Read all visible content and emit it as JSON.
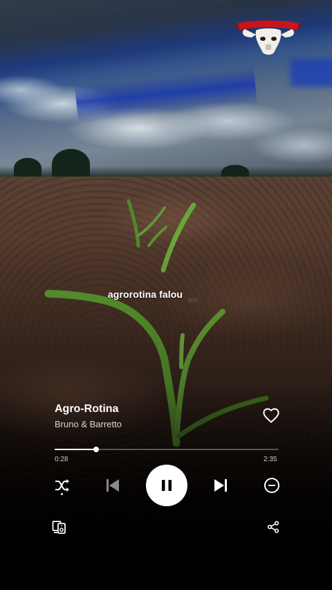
{
  "player": {
    "lyric_line": "agrorotina falou",
    "lyric_faint": "em",
    "track": {
      "title": "Agro-Rotina",
      "artist": "Bruno & Barretto"
    },
    "progress": {
      "elapsed": "0:28",
      "total": "2:35",
      "fraction": 0.186
    },
    "liked": false,
    "is_playing": true
  },
  "icons": {
    "logo": "bull-skull-logo",
    "like": "heart-icon",
    "shuffle": "shuffle-icon",
    "previous": "skip-previous-icon",
    "play_pause": "pause-icon",
    "next": "skip-next-icon",
    "remove": "minus-circle-icon",
    "devices": "connect-device-icon",
    "share": "share-icon"
  },
  "colors": {
    "logo_ribbon": "#c8151b",
    "accent": "#ffffff"
  }
}
